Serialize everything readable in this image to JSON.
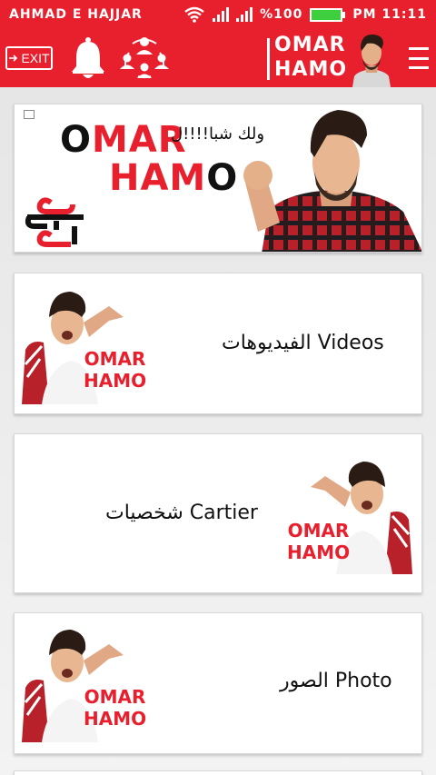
{
  "status_bar": {
    "carrier": "AHMAD E HAJJAR",
    "battery": "%100",
    "time": "PM 11:11"
  },
  "app_bar": {
    "exit_label": "EXIT",
    "brand_line1": "OMAR",
    "brand_line2": "HAMO"
  },
  "banner": {
    "title_line1_a": "O",
    "title_line1_b": "MAR",
    "title_line2_a": "HAM",
    "title_line2_b": "O",
    "tagline": "ولك شبا!!!!ل",
    "logo_text": "عمر حمو"
  },
  "cards": [
    {
      "label": "الفيديوهات Videos",
      "thumb_line1": "OMAR",
      "thumb_line2": "HAMO"
    },
    {
      "label": "شخصيات Cartier",
      "thumb_line1": "OMAR",
      "thumb_line2": "HAMO"
    },
    {
      "label": "الصور Photo",
      "thumb_line1": "OMAR",
      "thumb_line2": "HAMO"
    }
  ],
  "colors": {
    "brand_red": "#e8202e",
    "battery_green": "#3ecf3e",
    "background": "#ececec"
  },
  "icons": [
    "wifi-icon",
    "signal-icon",
    "battery-icon",
    "exit-icon",
    "bell-icon",
    "share-network-icon",
    "menu-icon"
  ]
}
